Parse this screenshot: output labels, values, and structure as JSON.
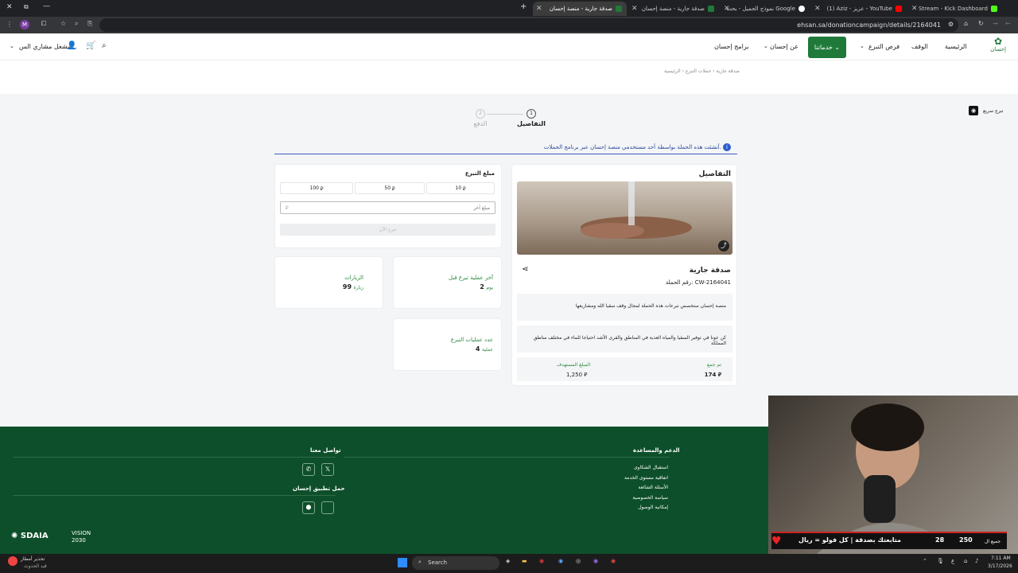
{
  "browser": {
    "tabs": [
      {
        "title": "Stream - Kick Dashboard",
        "color": "#53fc18"
      },
      {
        "title": "(1) Aziz - عزيز - YouTube",
        "color": "#ff0000"
      },
      {
        "title": "نموذج الجميل - بحث Google",
        "color": "#ffffff"
      },
      {
        "title": "صدقة جارية - منصة إحسان",
        "color": "#1f7a3a"
      },
      {
        "title": "صدقة جارية - منصة إحسان",
        "color": "#1f7a3a"
      }
    ],
    "url": "ehsan.sa/donationcampaign/details/2164041",
    "profile_initial": "M"
  },
  "header": {
    "nav": [
      "الرئيسية",
      "الوقف",
      "فرص التبرع",
      "خدماتنا",
      "عن إحسان",
      "برامج إحسان"
    ],
    "user": "مشغل مشاري الس...",
    "logo_text": "إحسان"
  },
  "breadcrumb": [
    "الرئيسية",
    "حملات التبرع",
    "صدقة جارية"
  ],
  "quick_donate": "تبرع سريع",
  "steps": [
    {
      "num": "1",
      "label": "التفاصيل"
    },
    {
      "num": "2",
      "label": "الدفع"
    }
  ],
  "notice": "أنشئت هذه الحملة بواسطة أحد مستخدمي منصة إحسان عبر برنامج الحملات.",
  "details": {
    "heading": "التفاصيل",
    "name": "صدقة جارية",
    "campaign_label": "رقم الحملة:",
    "campaign_no": "CW-2164041",
    "desc1": "منصة إحسان ستخصص تبرعات هذه الحملة لمجال وقف سقيا الله ومشاريعها",
    "desc2": "كن عونا في توفير السقيا والمياه العذبة في المناطق والقرى الأشد احتياجا للماء في مختلف مناطق المملكة",
    "collected_label": "تم جمع",
    "collected": "174",
    "target_label": "المبلغ المستهدف",
    "target": "1,250"
  },
  "donate": {
    "label": "مبلغ التبرع",
    "amounts": [
      "10",
      "50",
      "100"
    ],
    "other_placeholder": "مبلغ آخر",
    "submit": "تبرع الآن",
    "currency": "⃁"
  },
  "stats": {
    "last_label": "آخر عملية تبرع قبل",
    "last_value": "2",
    "last_unit": "يوم",
    "visits_label": "الزيارات",
    "visits_value": "99",
    "visits_unit": "زيارة",
    "ops_label": "عدد عمليات التبرع",
    "ops_value": "4",
    "ops_unit": "عملية"
  },
  "footer": {
    "support_title": "الدعم والمساعدة",
    "support_links": [
      "استقبال الشكاوى",
      "اتفاقية مستوى الخدمة",
      "الأسئلة الشائعة",
      "سياسة الخصوصية",
      "إمكانية الوصول"
    ],
    "contact_title": "تواصل معنا",
    "app_title": "حمل تطبيق إحسان",
    "sdaia": "SDAIA",
    "vision": "VISION 2030"
  },
  "stream": {
    "follows": "250",
    "count": "28",
    "ticker": "متابعتك بصدقة | كل فولو = ريال",
    "side": "جميع ال"
  },
  "taskbar": {
    "weather_title": "تحذير أمطار",
    "weather_sub": "قيد الحدوث",
    "search": "Search",
    "time": "7:11 AM",
    "date": "3/17/2026",
    "lang": "ع"
  }
}
